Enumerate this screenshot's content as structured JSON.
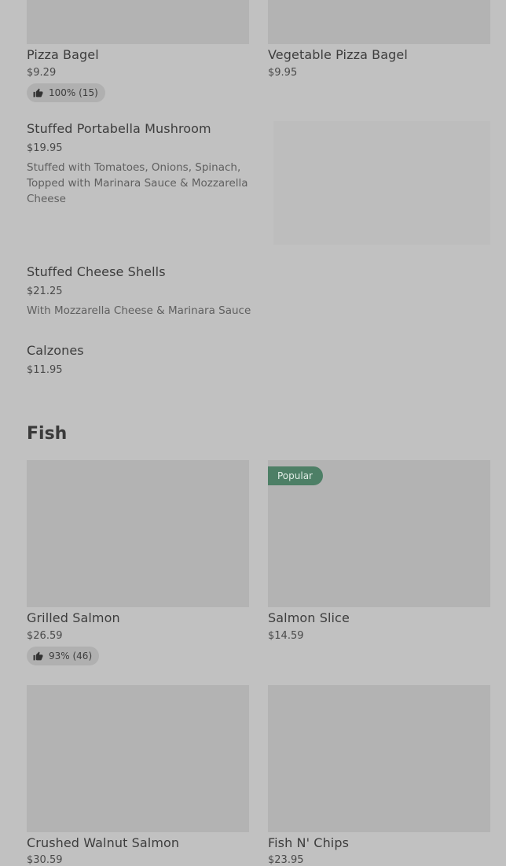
{
  "pizza": {
    "items": [
      {
        "name": "Pizza Bagel",
        "price": "$9.29",
        "rating": "100% (15)"
      },
      {
        "name": "Vegetable Pizza Bagel",
        "price": "$9.95"
      }
    ],
    "list": [
      {
        "name": "Stuffed Portabella Mushroom",
        "price": "$19.95",
        "description": "Stuffed with Tomatoes, Onions, Spinach, Topped with Marinara Sauce & Mozzarella Cheese"
      },
      {
        "name": "Stuffed Cheese Shells",
        "price": "$21.25",
        "description": "With Mozzarella Cheese & Marinara Sauce"
      },
      {
        "name": "Calzones",
        "price": "$11.95"
      }
    ]
  },
  "fish": {
    "title": "Fish",
    "items": [
      {
        "name": "Grilled Salmon",
        "price": "$26.59",
        "rating": "93% (46)"
      },
      {
        "name": "Salmon Slice",
        "price": "$14.59",
        "badge": "Popular"
      },
      {
        "name": "Crushed Walnut Salmon",
        "price": "$30.59"
      },
      {
        "name": "Fish N' Chips",
        "price": "$23.95"
      }
    ]
  },
  "icons": {
    "rating": "thumbs-up-icon"
  }
}
